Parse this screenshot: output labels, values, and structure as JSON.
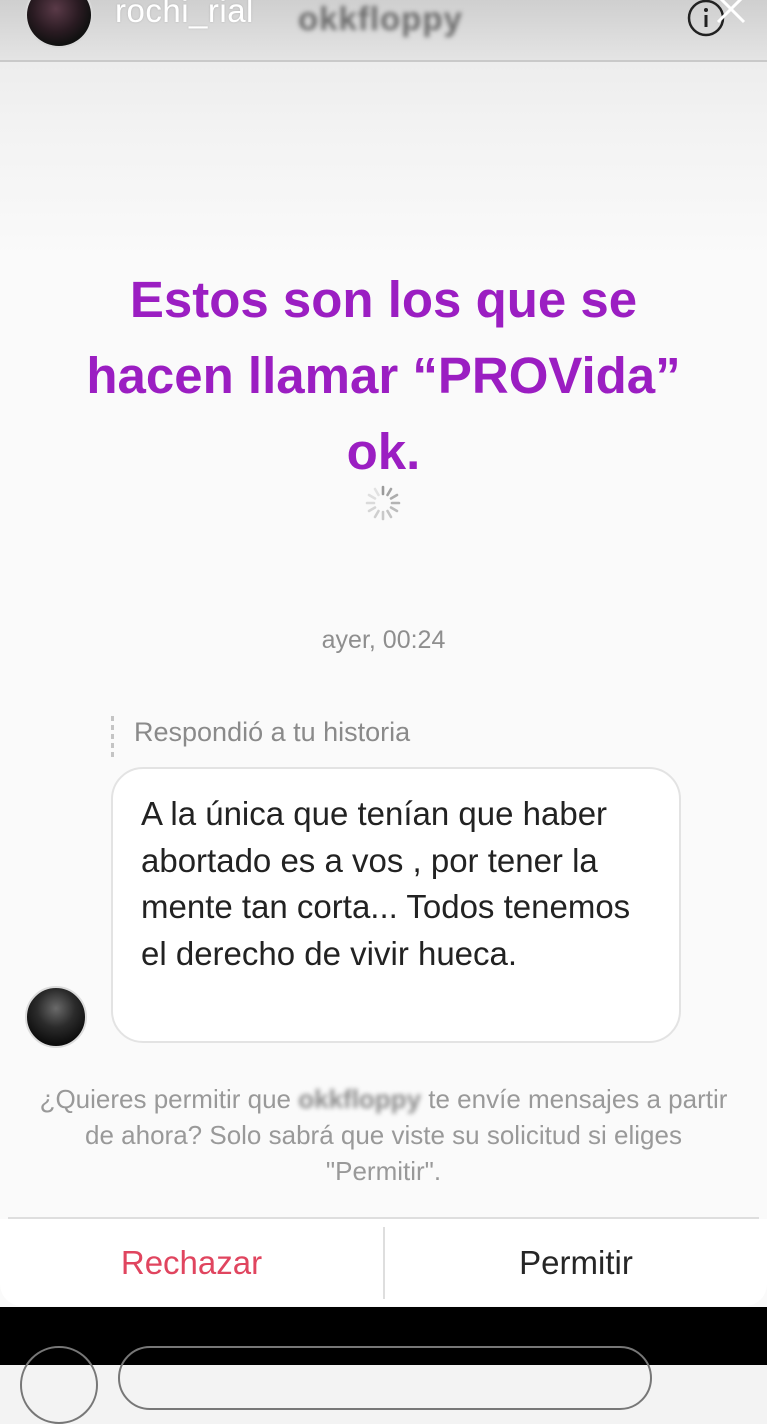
{
  "header": {
    "username": "rochi_rial",
    "blurred_name": "okkfloppy",
    "info_icon": "info-icon",
    "close_icon": "close-icon"
  },
  "story": {
    "line1": "Estos son los que se",
    "line2": "hacen llamar “PROVida”",
    "line3": "ok."
  },
  "message": {
    "timestamp": "ayer, 00:24",
    "reply_label": "Respondió a tu historia",
    "text": "A la única que tenían que haber abortado es a vos , por tener la mente tan corta... Todos tenemos el derecho de vivir hueca."
  },
  "request": {
    "prefix": "¿Quieres permitir que",
    "blurred_name": "okkfloppy",
    "suffix": "te envíe mensajes a partir de ahora? Solo sabrá que viste su solicitud si eliges \"Permitir\"."
  },
  "buttons": {
    "reject": "Rechazar",
    "allow": "Permitir"
  },
  "colors": {
    "story_text": "#9b1ec2",
    "reject": "#e0455f",
    "allow": "#262626"
  }
}
